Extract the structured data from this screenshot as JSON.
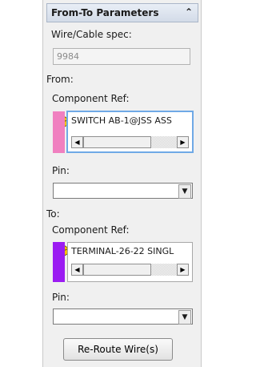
{
  "header": {
    "title": "From-To Parameters",
    "collapse_icon": "double-chevron-up-icon"
  },
  "wire_spec": {
    "label": "Wire/Cable spec:",
    "value": "9984"
  },
  "from": {
    "section_label": "From:",
    "component_ref_label": "Component Ref:",
    "component_ref_value": "SWITCH AB-1@JSS ASS",
    "swatch_color": "#f080c0",
    "pin_label": "Pin:",
    "pin_value": ""
  },
  "to": {
    "section_label": "To:",
    "component_ref_label": "Component Ref:",
    "component_ref_value": "TERMINAL-26-22 SINGL",
    "swatch_color": "#9b1cf2",
    "pin_label": "Pin:",
    "pin_value": ""
  },
  "reroute_button": {
    "label": "Re-Route Wire(s)"
  },
  "icons": {
    "component_icon": "component-connector-icon",
    "scroll_left": "arrow-left-icon",
    "scroll_right": "arrow-right-icon",
    "dropdown": "dropdown-arrow-icon"
  }
}
